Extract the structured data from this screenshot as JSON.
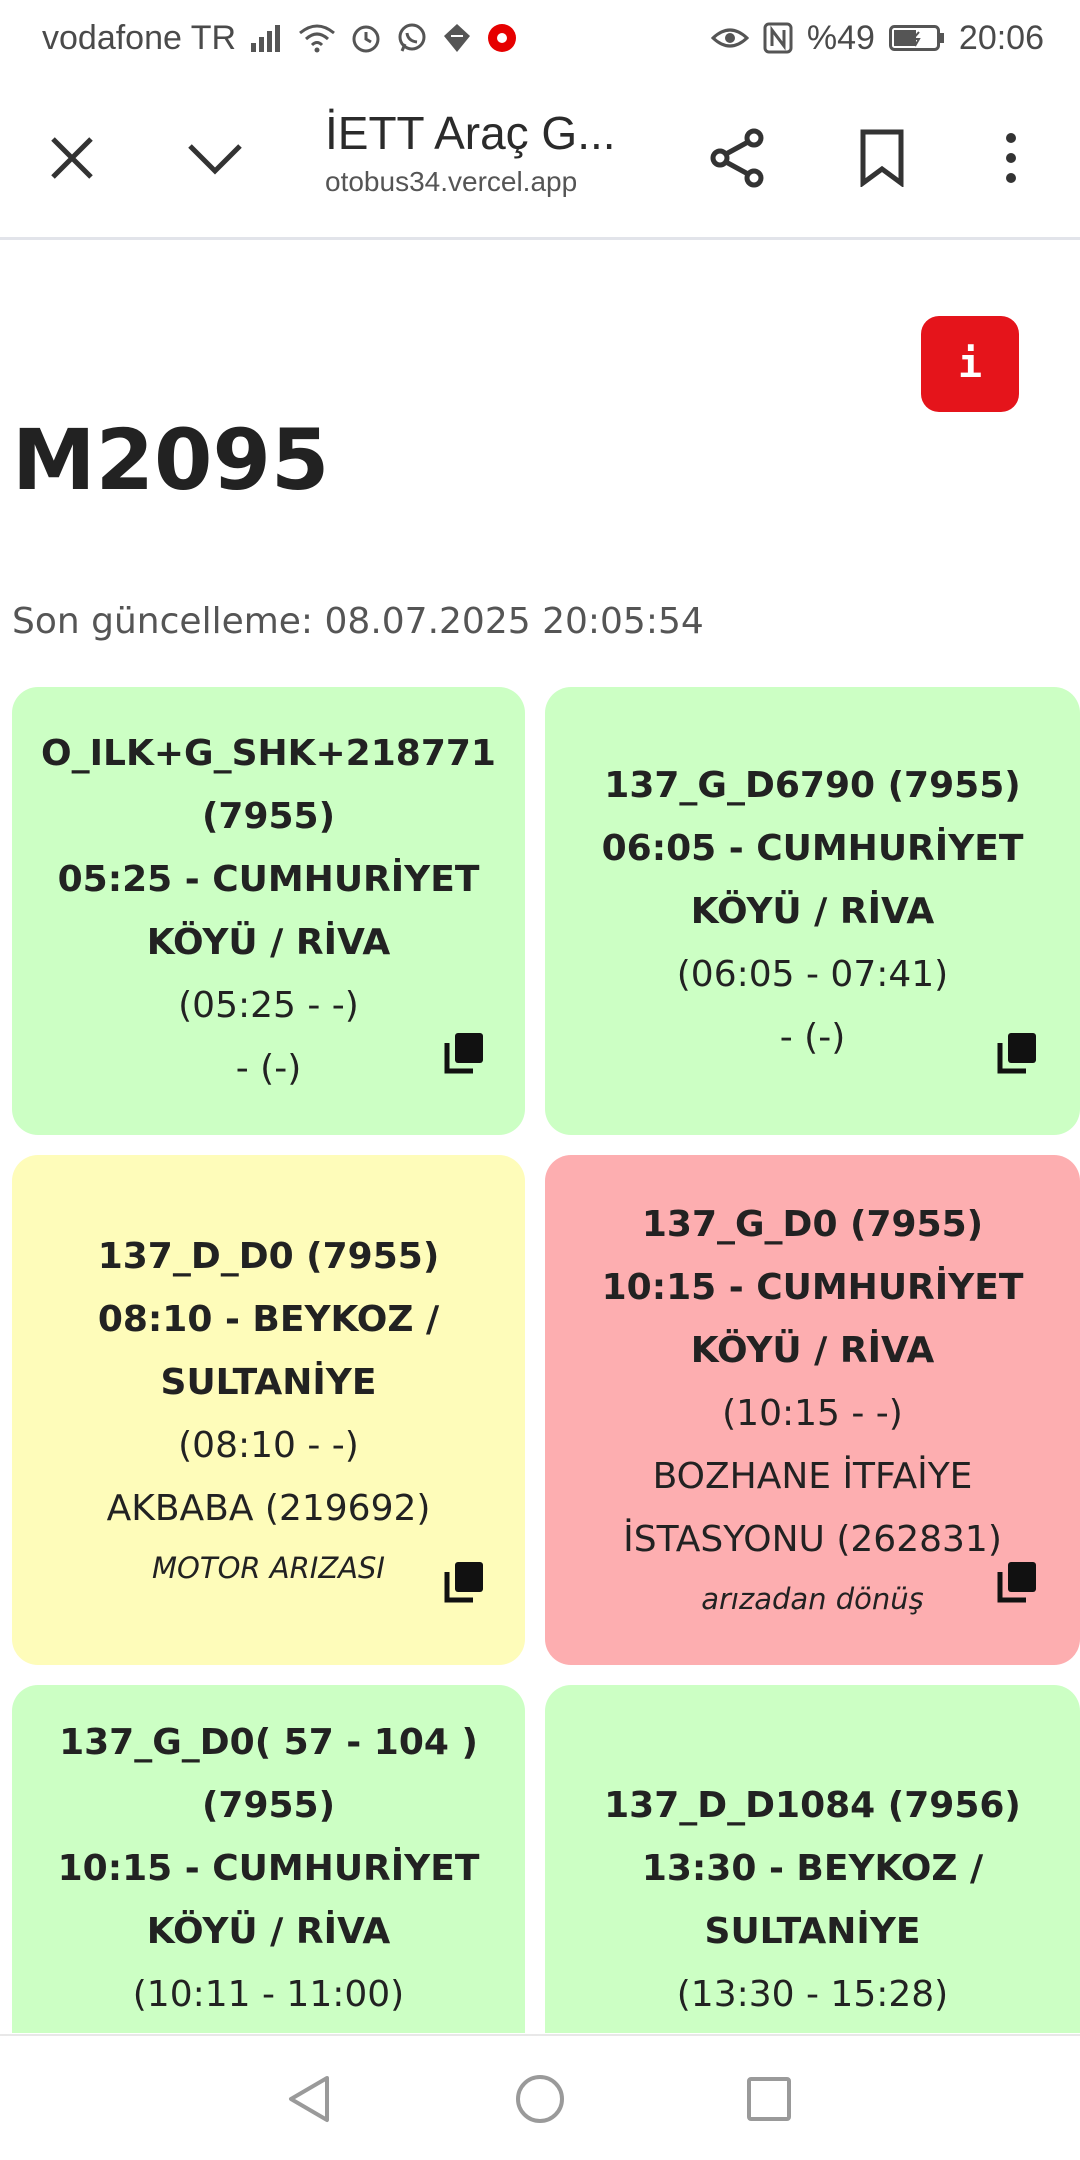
{
  "status_bar": {
    "carrier": "vodafone TR",
    "battery": "%49",
    "time": "20:06",
    "icons_left": [
      "signal-icon",
      "wifi-icon",
      "alarm-icon",
      "whatsapp-icon",
      "app-icon",
      "vodafone-icon"
    ],
    "icons_right": [
      "eye-icon",
      "nfc-icon",
      "battery-icon"
    ]
  },
  "browser": {
    "title": "İETT Araç G...",
    "url": "otobus34.vercel.app"
  },
  "page": {
    "info_label": "i",
    "vehicle_id": "M2095",
    "last_update": "Son güncelleme: 08.07.2025 20:05:54"
  },
  "colors": {
    "green": "#ccffc4",
    "yellow": "#fefcba",
    "red": "#fdaeb0",
    "info_button": "#e5141b"
  },
  "cards": [
    {
      "status": "green",
      "code": "O_ILK+G_SHK+218771",
      "code2": "(7955)",
      "trip": "05:25 - CUMHURİYET KÖYÜ / RİVA",
      "times": "(05:25 - -)",
      "location": "- (-)",
      "note": ""
    },
    {
      "status": "green",
      "code": "137_G_D6790 (7955)",
      "code2": "",
      "trip": "06:05 - CUMHURİYET KÖYÜ / RİVA",
      "times": "(06:05 - 07:41)",
      "location": "- (-)",
      "note": ""
    },
    {
      "status": "yellow",
      "code": "137_D_D0 (7955)",
      "code2": "",
      "trip": "08:10 - BEYKOZ / SULTANİYE",
      "times": "(08:10 - -)",
      "location": "AKBABA (219692)",
      "note": "MOTOR ARIZASI"
    },
    {
      "status": "red",
      "code": "137_G_D0 (7955)",
      "code2": "",
      "trip": "10:15 - CUMHURİYET KÖYÜ / RİVA",
      "times": "(10:15 - -)",
      "location": "BOZHANE İTFAİYE İSTASYONU (262831)",
      "note": "arızadan dönüş"
    },
    {
      "status": "green",
      "code": "137_G_D0( 57 - 104 )",
      "code2": "(7955)",
      "trip": "10:15 - CUMHURİYET KÖYÜ / RİVA",
      "times": "(10:11 - 11:00)",
      "location": "",
      "note": ""
    },
    {
      "status": "green",
      "code": "137_D_D1084 (7956)",
      "code2": "",
      "trip": "13:30 - BEYKOZ / SULTANİYE",
      "times": "(13:30 - 15:28)",
      "location": "",
      "note": ""
    }
  ],
  "nav": [
    "back-icon",
    "home-icon",
    "recents-icon"
  ]
}
